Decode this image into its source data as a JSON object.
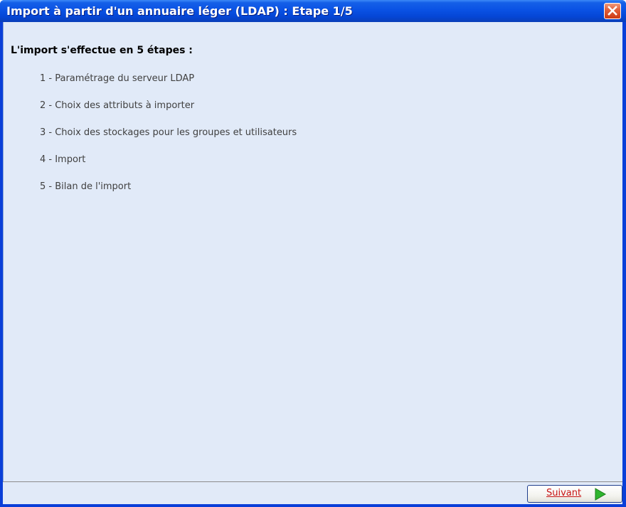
{
  "window": {
    "title": "Import à partir d'un annuaire léger (LDAP) : Etape 1/5"
  },
  "content": {
    "heading": "L'import s'effectue en 5 étapes :",
    "steps": [
      "1 - Paramétrage du serveur LDAP",
      "2 - Choix des attributs à importer",
      "3 - Choix des stockages pour les groupes et utilisateurs",
      "4 - Import",
      "5 - Bilan de l'import"
    ]
  },
  "footer": {
    "next_label": "Suivant"
  },
  "icons": {
    "close": "close-icon",
    "next": "play-arrow-icon"
  },
  "colors": {
    "titlebar": "#0a52e4",
    "client_background": "#e1eaf8",
    "close_button": "#e2613c",
    "next_label": "#c81414",
    "next_arrow": "#2fb52f"
  }
}
